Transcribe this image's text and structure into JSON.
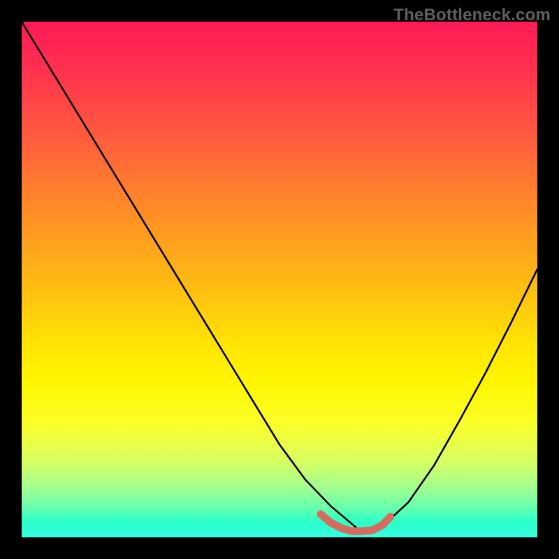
{
  "watermark": "TheBottleneck.com",
  "chart_data": {
    "type": "line",
    "title": "",
    "xlabel": "",
    "ylabel": "",
    "xlim": [
      0,
      1
    ],
    "ylim": [
      0,
      1
    ],
    "series": [
      {
        "name": "black-curve",
        "x": [
          0.0,
          0.05,
          0.1,
          0.15,
          0.2,
          0.25,
          0.3,
          0.35,
          0.4,
          0.45,
          0.5,
          0.55,
          0.6,
          0.65,
          0.675,
          0.7,
          0.75,
          0.8,
          0.85,
          0.9,
          0.95,
          1.0
        ],
        "y": [
          1.0,
          0.918,
          0.836,
          0.754,
          0.672,
          0.59,
          0.508,
          0.426,
          0.344,
          0.262,
          0.18,
          0.112,
          0.06,
          0.018,
          0.012,
          0.022,
          0.068,
          0.14,
          0.228,
          0.32,
          0.418,
          0.52
        ]
      },
      {
        "name": "red-flat-marker",
        "x": [
          0.58,
          0.6,
          0.62,
          0.64,
          0.66,
          0.68,
          0.7,
          0.715
        ],
        "y": [
          0.045,
          0.028,
          0.018,
          0.012,
          0.012,
          0.014,
          0.024,
          0.04
        ]
      }
    ],
    "colors": {
      "black_curve": "#000000",
      "red_marker": "#d86a5f",
      "gradient_top": "#ff1a55",
      "gradient_mid": "#ffe205",
      "gradient_bottom": "#35ffe3",
      "background": "#000000"
    }
  }
}
